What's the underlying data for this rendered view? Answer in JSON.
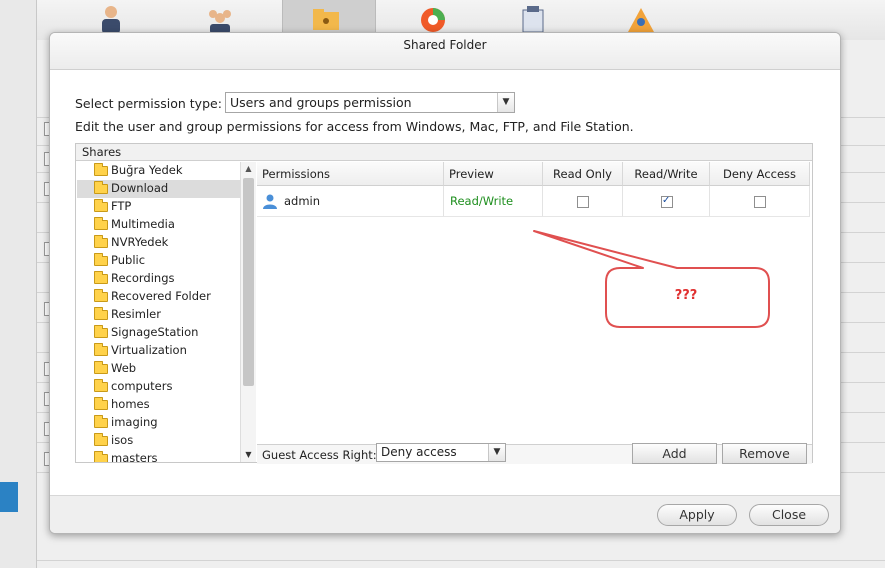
{
  "dialog": {
    "title": "Shared Folder",
    "permission_type_label": "Select permission type:",
    "permission_type_value": "Users and groups permission",
    "description": "Edit the user and group permissions for access from Windows, Mac, FTP, and File Station.",
    "shares_header": "Shares",
    "shares": [
      {
        "name": "Buğra Yedek",
        "selected": false
      },
      {
        "name": "Download",
        "selected": true
      },
      {
        "name": "FTP",
        "selected": false
      },
      {
        "name": "Multimedia",
        "selected": false
      },
      {
        "name": "NVRYedek",
        "selected": false
      },
      {
        "name": "Public",
        "selected": false
      },
      {
        "name": "Recordings",
        "selected": false
      },
      {
        "name": "Recovered Folder",
        "selected": false
      },
      {
        "name": "Resimler",
        "selected": false
      },
      {
        "name": "SignageStation",
        "selected": false
      },
      {
        "name": "Virtualization",
        "selected": false
      },
      {
        "name": "Web",
        "selected": false
      },
      {
        "name": "computers",
        "selected": false
      },
      {
        "name": "homes",
        "selected": false
      },
      {
        "name": "imaging",
        "selected": false
      },
      {
        "name": "isos",
        "selected": false
      },
      {
        "name": "masters",
        "selected": false
      }
    ],
    "columns": {
      "permissions": "Permissions",
      "preview": "Preview",
      "read_only": "Read Only",
      "read_write": "Read/Write",
      "deny_access": "Deny Access"
    },
    "rows": [
      {
        "user": "admin",
        "preview": "Read/Write",
        "read_only": false,
        "read_write": true,
        "deny_access": false
      }
    ],
    "guest_access_label": "Guest Access Right:",
    "guest_access_value": "Deny access",
    "add_label": "Add",
    "remove_label": "Remove",
    "apply_label": "Apply",
    "close_label": "Close"
  },
  "callout": {
    "text": "???"
  },
  "colors": {
    "preview_green": "#1f8f1f",
    "callout_red": "#e05050",
    "selection_blue": "#2b82c4"
  }
}
